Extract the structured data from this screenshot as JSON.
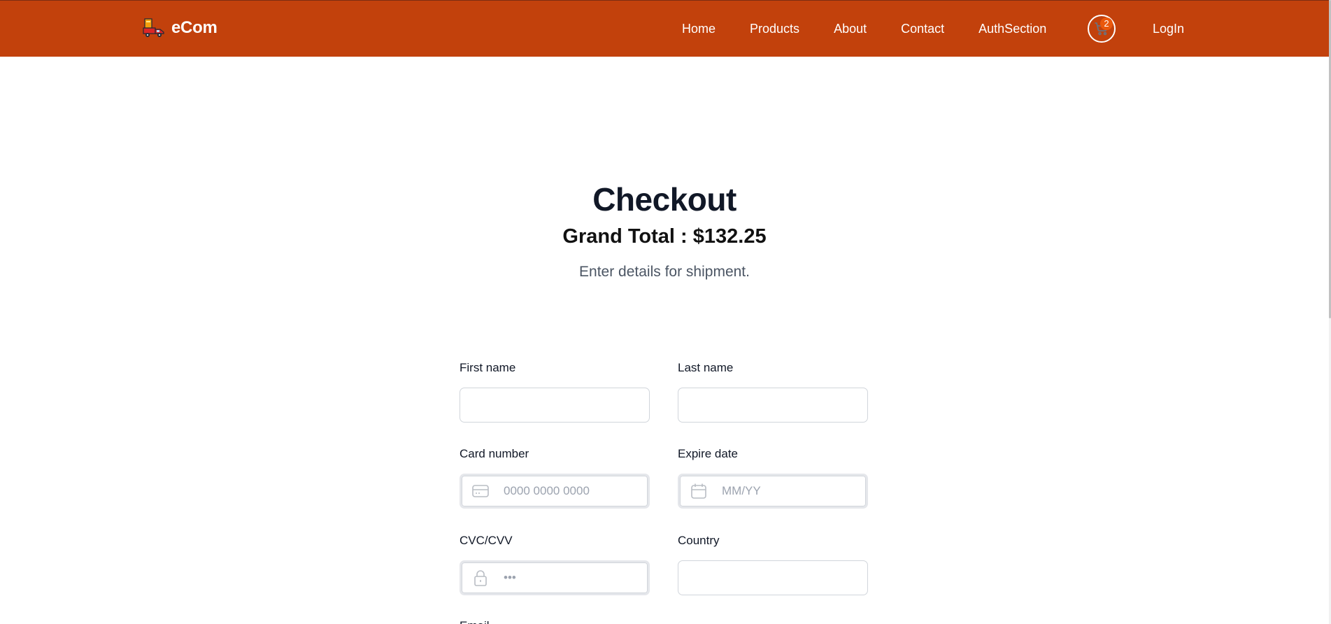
{
  "navbar": {
    "brand": "eCom",
    "links": [
      "Home",
      "Products",
      "About",
      "Contact",
      "AuthSection"
    ],
    "cart_count": "2",
    "login_label": "LogIn",
    "background_color": "#c2410c"
  },
  "checkout": {
    "title": "Checkout",
    "grand_total": "Grand Total : $132.25",
    "subtitle": "Enter details for shipment."
  },
  "form": {
    "first_name": {
      "label": "First name",
      "value": "",
      "placeholder": ""
    },
    "last_name": {
      "label": "Last name",
      "value": "",
      "placeholder": ""
    },
    "card_number": {
      "label": "Card number",
      "value": "",
      "placeholder": "0000 0000 0000",
      "icon": "credit-card-icon"
    },
    "expire_date": {
      "label": "Expire date",
      "value": "",
      "placeholder": "MM/YY",
      "icon": "calendar-icon"
    },
    "cvc": {
      "label": "CVC/CVV",
      "value": "",
      "placeholder": "•••",
      "icon": "lock-icon"
    },
    "country": {
      "label": "Country",
      "value": "",
      "placeholder": ""
    },
    "email": {
      "label": "Email"
    }
  }
}
